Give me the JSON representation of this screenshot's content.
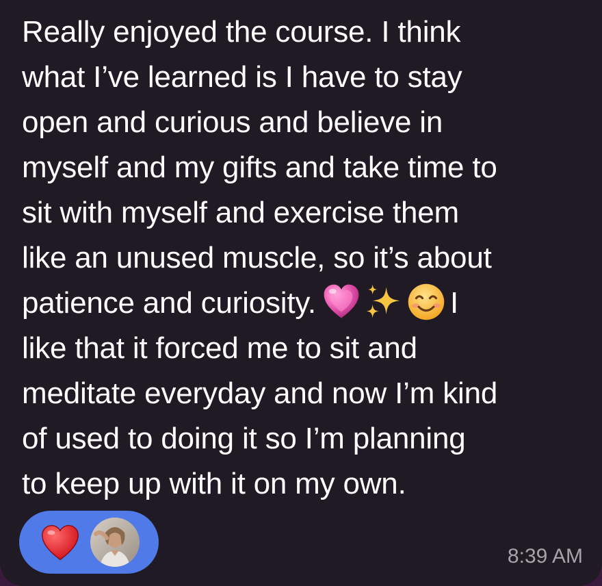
{
  "message": {
    "lines": [
      "Really enjoyed the course. I think",
      "what I’ve learned is I have to stay",
      "open and curious and believe in",
      "myself and my gifts and take time to",
      "sit with myself and exercise them",
      "like an unused muscle, so it’s about",
      "patience and curiosity.",
      "like that it forced me to sit and",
      "meditate everyday and now I’m kind",
      "of used to doing it so I’m planning",
      "to keep up with it on my own."
    ],
    "after_emoji_text": "I",
    "emojis": [
      "growing-heart-icon",
      "sparkles-icon",
      "smiling-face-icon"
    ]
  },
  "reaction": {
    "emoji": "red-heart-icon",
    "pill_color": "#4f7ae8"
  },
  "timestamp": "8:39 AM",
  "colors": {
    "bubble_background": "#1f1a23",
    "text": "#ffffff",
    "timestamp": "#a6a3aa"
  }
}
